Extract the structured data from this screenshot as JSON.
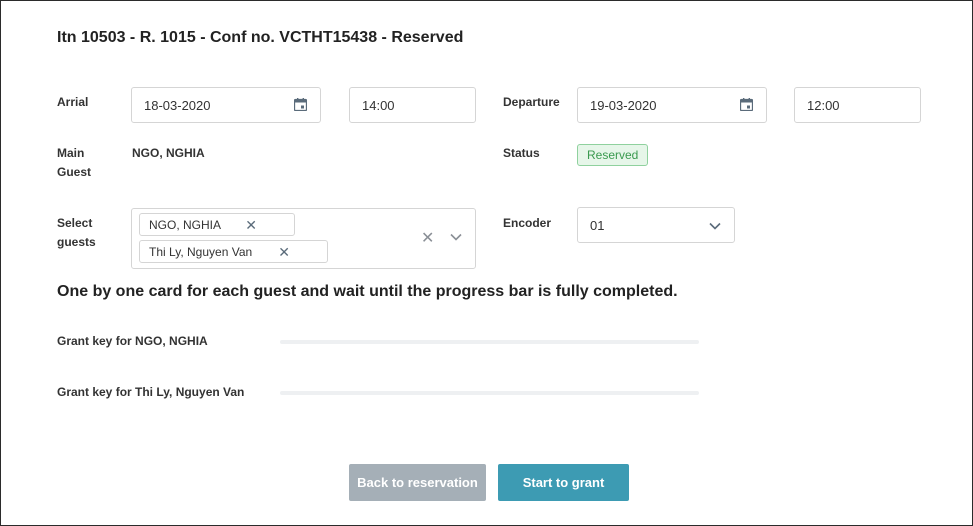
{
  "title": "Itn 10503 - R. 1015 - Conf no. VCTHT15438 - Reserved",
  "arrival": {
    "label": "Arrial",
    "date": "18-03-2020",
    "time": "14:00"
  },
  "departure": {
    "label": "Departure",
    "date": "19-03-2020",
    "time": "12:00"
  },
  "main_guest": {
    "label_line1": "Main",
    "label_line2": "Guest",
    "value": "NGO, NGHIA"
  },
  "status": {
    "label": "Status",
    "value": "Reserved",
    "color": "#3a9a4f"
  },
  "select_guests": {
    "label_line1": "Select",
    "label_line2": "guests",
    "selected": [
      "NGO, NGHIA",
      "Thi Ly, Nguyen Van"
    ]
  },
  "encoder": {
    "label": "Encoder",
    "value": "01"
  },
  "instruction": "One by one card for each guest and wait until the progress bar is fully completed.",
  "grants": [
    {
      "label": "Grant key for NGO, NGHIA",
      "progress": 0
    },
    {
      "label": "Grant key for Thi Ly, Nguyen Van",
      "progress": 0
    }
  ],
  "buttons": {
    "back": "Back to reservation",
    "start": "Start to grant"
  },
  "icons": {
    "date_picker": "calendar-icon",
    "tag_remove": "close-icon",
    "clear": "clear-icon",
    "dropdown": "chevron-down-icon"
  },
  "colors": {
    "primary": "#3d9bb3",
    "secondary": "#a5afb7",
    "badge_bg": "#e6f6e9"
  }
}
